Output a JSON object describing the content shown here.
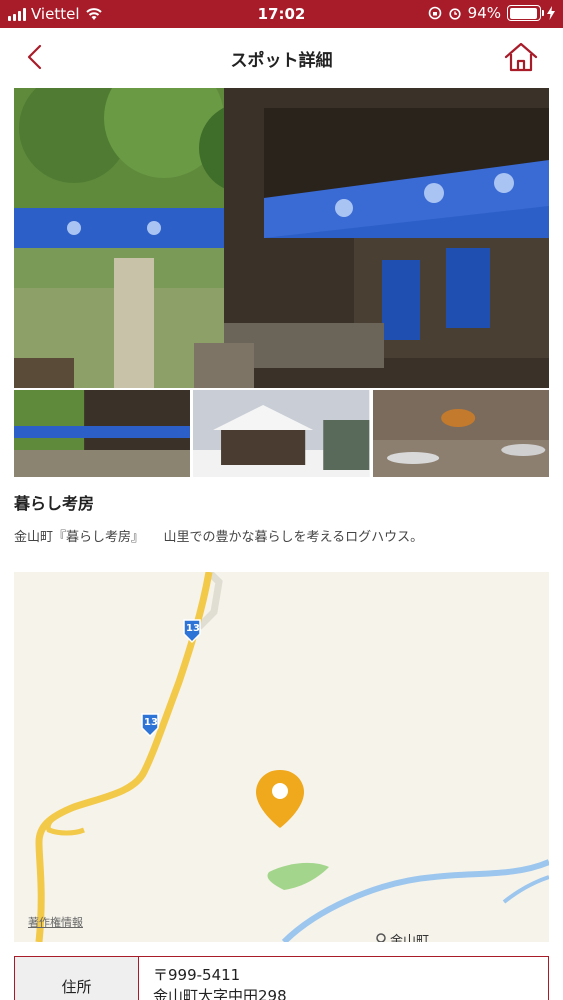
{
  "status_bar": {
    "carrier": "Viettel",
    "time": "17:02",
    "battery_percent": "94%",
    "battery_level": 0.94
  },
  "nav": {
    "title": "スポット詳細",
    "back_icon": "chevron-left-icon",
    "home_icon": "home-icon",
    "accent_color": "#a81c2a"
  },
  "spot": {
    "name": "暮らし考房",
    "description": "金山町『暮らし考房』　　山里での豊かな暮らしを考えるログハウス。"
  },
  "map": {
    "route_labels": [
      "13",
      "13"
    ],
    "attribution": "著作権情報",
    "place_label": "金山町",
    "pin_color": "#f0a81c"
  },
  "info": {
    "rows": [
      {
        "label": "住所",
        "value_line1": "〒999-5411",
        "value_line2": "金山町大字中田298"
      }
    ]
  }
}
